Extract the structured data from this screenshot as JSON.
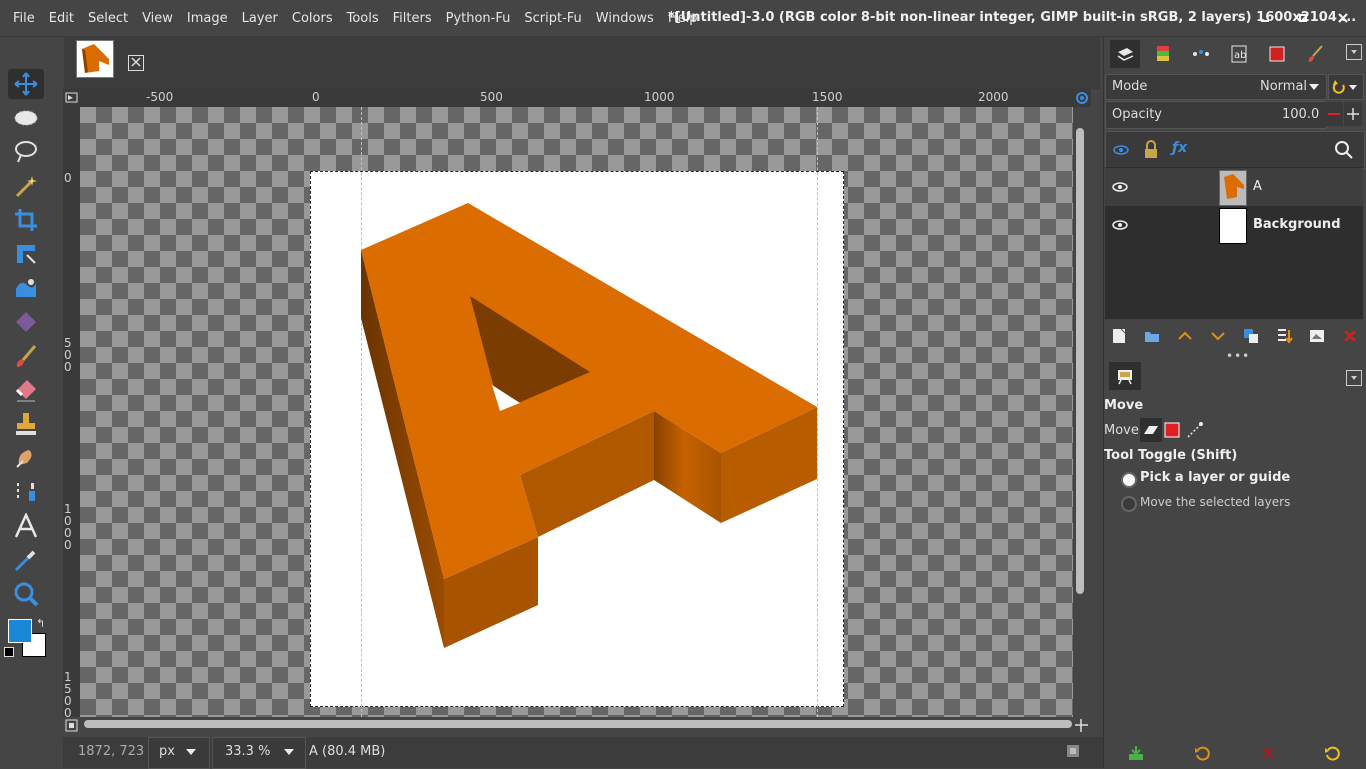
{
  "menubar": {
    "items": [
      "File",
      "Edit",
      "Select",
      "View",
      "Image",
      "Layer",
      "Colors",
      "Tools",
      "Filters",
      "Python-Fu",
      "Script-Fu",
      "Windows",
      "Help"
    ]
  },
  "window": {
    "title": "*[Untitled]-3.0 (RGB color 8-bit non-linear integer, GIMP built-in sRGB, 2 layers) 1600x2104 ..."
  },
  "image_tab": {
    "thumbnail_label": "A",
    "close_icon": "close-icon"
  },
  "rulers": {
    "horizontal_labels": [
      "-500",
      "0",
      "500",
      "1000",
      "1500",
      "2000"
    ],
    "vertical_labels": [
      "0",
      "500",
      "1000",
      "1500"
    ]
  },
  "canvas": {
    "letter": "A",
    "letter_color_front": "#DA6C00",
    "letter_color_side": "#8A4100"
  },
  "colors": {
    "foreground": "#1887D8",
    "background": "#FFFFFF"
  },
  "status": {
    "coordinates": "1872, 723",
    "unit": "px",
    "zoom": "33.3 %",
    "layer_info": "A (80.4 MB)"
  },
  "layers_panel": {
    "mode_label": "Mode",
    "mode_value": "Normal",
    "opacity_label": "Opacity",
    "opacity_value": "100.0",
    "layers": [
      {
        "name": "A",
        "visible": true
      },
      {
        "name": "Background",
        "visible": true
      }
    ]
  },
  "tool_options": {
    "title": "Move",
    "move_label": "Move:",
    "toggle_label": "Tool Toggle  (Shift)",
    "options": [
      "Pick a layer or guide",
      "Move the selected layers"
    ],
    "selected_option": "Pick a layer or guide"
  }
}
